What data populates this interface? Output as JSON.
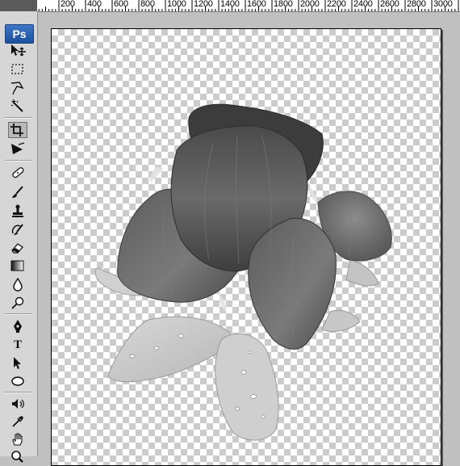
{
  "app": {
    "logo_text": "Ps"
  },
  "ruler": {
    "labels": [
      "200",
      "400",
      "600",
      "800",
      "1000",
      "1200",
      "1400",
      "1600",
      "1800",
      "2000",
      "2200",
      "2400",
      "2600",
      "2800",
      "3000"
    ]
  },
  "tools": [
    {
      "name": "move-tool",
      "icon": "move-icon"
    },
    {
      "name": "marquee-tool",
      "icon": "marquee-icon"
    },
    {
      "name": "lasso-tool",
      "icon": "polygonal-lasso-icon"
    },
    {
      "name": "magic-wand-tool",
      "icon": "magic-wand-icon"
    },
    {
      "name": "crop-tool",
      "icon": "crop-icon",
      "active": true
    },
    {
      "name": "slice-tool",
      "icon": "slice-icon"
    },
    {
      "name": "healing-brush-tool",
      "icon": "bandage-icon"
    },
    {
      "name": "brush-tool",
      "icon": "brush-icon"
    },
    {
      "name": "clone-stamp-tool",
      "icon": "stamp-icon"
    },
    {
      "name": "history-brush-tool",
      "icon": "history-brush-icon"
    },
    {
      "name": "eraser-tool",
      "icon": "eraser-icon"
    },
    {
      "name": "gradient-tool",
      "icon": "gradient-icon"
    },
    {
      "name": "blur-tool",
      "icon": "blur-drop-icon"
    },
    {
      "name": "dodge-tool",
      "icon": "dodge-icon"
    },
    {
      "name": "pen-tool",
      "icon": "pen-icon"
    },
    {
      "name": "type-tool",
      "icon": "type-icon",
      "label": "T"
    },
    {
      "name": "path-selection-tool",
      "icon": "path-selection-icon"
    },
    {
      "name": "shape-tool",
      "icon": "ellipse-icon"
    },
    {
      "name": "notes-tool",
      "icon": "audio-note-icon"
    },
    {
      "name": "eyedropper-tool",
      "icon": "eyedropper-icon"
    },
    {
      "name": "hand-tool",
      "icon": "hand-icon"
    },
    {
      "name": "zoom-tool",
      "icon": "zoom-icon"
    }
  ],
  "document": {
    "content": "flower-image-transparent-background"
  },
  "colors": {
    "panel": "#d6d6d6",
    "workspace": "#c0c0c0",
    "logo": "#2a62b3"
  }
}
